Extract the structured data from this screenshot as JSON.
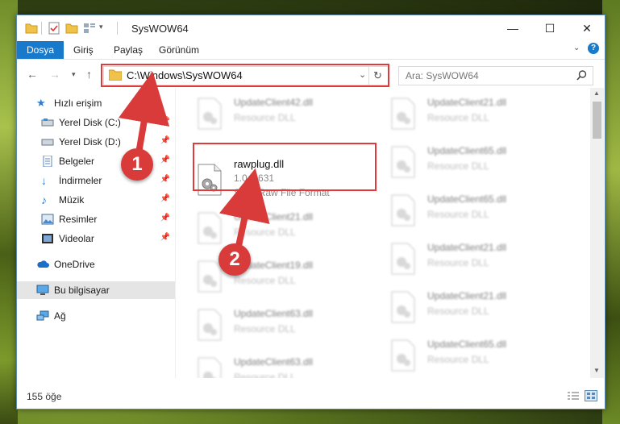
{
  "window": {
    "title": "SysWOW64"
  },
  "titlebar": {
    "minimize": "—",
    "maximize": "☐",
    "close": "✕"
  },
  "ribbon": {
    "tabs": [
      "Dosya",
      "Giriş",
      "Paylaş",
      "Görünüm"
    ],
    "help": "?"
  },
  "address": {
    "path": "C:\\Windows\\SysWOW64",
    "search_placeholder": "Ara: SysWOW64"
  },
  "sidebar": {
    "items": [
      {
        "label": "Hızlı erişim",
        "icon": "star-icon"
      },
      {
        "label": "Yerel Disk (C:)",
        "icon": "drive-icon",
        "pinned": true
      },
      {
        "label": "Yerel Disk (D:)",
        "icon": "drive-icon",
        "pinned": true
      },
      {
        "label": "Belgeler",
        "icon": "documents-icon",
        "pinned": true
      },
      {
        "label": "İndirmeler",
        "icon": "download-icon",
        "pinned": true
      },
      {
        "label": "Müzik",
        "icon": "music-icon",
        "pinned": true
      },
      {
        "label": "Resimler",
        "icon": "pictures-icon",
        "pinned": true
      },
      {
        "label": "Videolar",
        "icon": "videos-icon",
        "pinned": true
      },
      {
        "label": "OneDrive",
        "icon": "cloud-icon"
      },
      {
        "label": "Bu bilgisayar",
        "icon": "computer-icon",
        "selected": true
      },
      {
        "label": "Ağ",
        "icon": "network-icon"
      }
    ]
  },
  "files": {
    "highlighted": {
      "name": "rawplug.dll",
      "version": "1.0.0.631",
      "description": "Sony Raw File Format"
    },
    "left_column": [
      {
        "name": "UpdateClient42.dll",
        "desc": "Resource DLL"
      },
      {
        "name": "UpdateClient21.dll",
        "desc": "Resource DLL"
      },
      {
        "name": "UpdateClient19.dll",
        "desc": "Resource DLL"
      },
      {
        "name": "UpdateClient63.dll",
        "desc": "Resource DLL"
      },
      {
        "name": "UpdateClient63.dll",
        "desc": "Resource DLL"
      }
    ],
    "right_column": [
      {
        "name": "UpdateClient21.dll",
        "desc": "Resource DLL"
      },
      {
        "name": "UpdateClient65.dll",
        "desc": "Resource DLL"
      },
      {
        "name": "UpdateClient65.dll",
        "desc": "Resource DLL"
      },
      {
        "name": "UpdateClient21.dll",
        "desc": "Resource DLL"
      },
      {
        "name": "UpdateClient21.dll",
        "desc": "Resource DLL"
      },
      {
        "name": "UpdateClient65.dll",
        "desc": "Resource DLL"
      },
      {
        "name": "UpdateClient65.dll",
        "desc": "Resource DLL"
      }
    ]
  },
  "status": {
    "count": "155 öğe"
  },
  "callouts": {
    "one": "1",
    "two": "2"
  },
  "colors": {
    "accent": "#1979ca",
    "highlight_box": "#e03a3a",
    "callout": "#d93a3a"
  }
}
